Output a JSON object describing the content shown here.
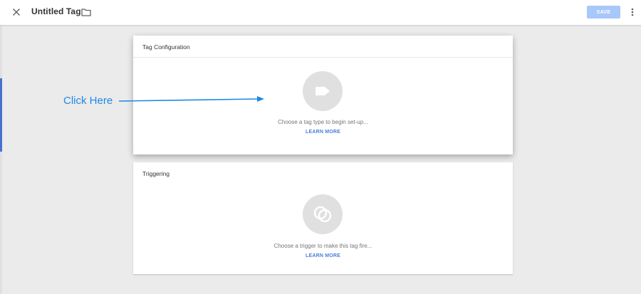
{
  "header": {
    "title": "Untitled Tag",
    "save_label": "SAVE"
  },
  "tag_configuration": {
    "title": "Tag Configuration",
    "prompt": "Choose a tag type to begin set-up...",
    "learn_more": "LEARN MORE"
  },
  "triggering": {
    "title": "Triggering",
    "prompt": "Choose a trigger to make this tag fire...",
    "learn_more": "LEARN MORE"
  },
  "annotation": {
    "text": "Click Here"
  },
  "colors": {
    "save_button": "#a8c7fa",
    "link": "#4a7fd8",
    "annotation": "#1e88e5",
    "background": "#ebebeb"
  },
  "icons": {
    "close": "close-icon",
    "folder": "folder-icon",
    "more": "more-vert-icon",
    "tag": "tag-icon",
    "trigger": "trigger-icon"
  }
}
